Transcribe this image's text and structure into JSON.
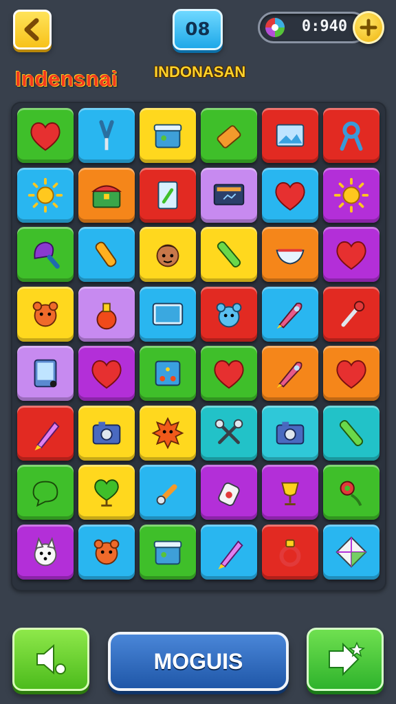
{
  "header": {
    "level": "08",
    "timer": "0:940",
    "title_left": "Indensnai",
    "title_center": "INDONASAN"
  },
  "footer": {
    "center_label": "MOGUIS"
  },
  "colors": {
    "green": "#3fbf2a",
    "blue": "#29b6f0",
    "yellow": "#ffd81e",
    "red": "#e22a22",
    "orange": "#f5861a",
    "purple": "#b32fd8",
    "lavender": "#c78af0",
    "cyan": "#2fc8d8",
    "teal": "#22c2c8"
  },
  "board": {
    "rows": [
      [
        {
          "color": "green",
          "icon": "heart-icon"
        },
        {
          "color": "blue",
          "icon": "scissors-icon"
        },
        {
          "color": "yellow",
          "icon": "box-icon"
        },
        {
          "color": "green",
          "icon": "eraser-icon"
        },
        {
          "color": "red",
          "icon": "picture-icon"
        },
        {
          "color": "red",
          "icon": "ribbon-icon"
        }
      ],
      [
        {
          "color": "blue",
          "icon": "sun-icon"
        },
        {
          "color": "orange",
          "icon": "treasure-chest-icon"
        },
        {
          "color": "red",
          "icon": "card-icon"
        },
        {
          "color": "lavender",
          "icon": "monitor-icon"
        },
        {
          "color": "blue",
          "icon": "heart-icon"
        },
        {
          "color": "purple",
          "icon": "sun-icon"
        }
      ],
      [
        {
          "color": "green",
          "icon": "brush-icon"
        },
        {
          "color": "blue",
          "icon": "marker-icon"
        },
        {
          "color": "yellow",
          "icon": "face-icon"
        },
        {
          "color": "yellow",
          "icon": "crayon-icon"
        },
        {
          "color": "orange",
          "icon": "bowl-icon"
        },
        {
          "color": "purple",
          "icon": "heart-icon"
        }
      ],
      [
        {
          "color": "yellow",
          "icon": "monster-icon"
        },
        {
          "color": "lavender",
          "icon": "potion-icon"
        },
        {
          "color": "blue",
          "icon": "tablet-icon"
        },
        {
          "color": "red",
          "icon": "creature-icon"
        },
        {
          "color": "blue",
          "icon": "rocket-icon"
        },
        {
          "color": "red",
          "icon": "wand-icon"
        }
      ],
      [
        {
          "color": "lavender",
          "icon": "device-icon"
        },
        {
          "color": "purple",
          "icon": "heart-icon"
        },
        {
          "color": "green",
          "icon": "game-board-icon"
        },
        {
          "color": "green",
          "icon": "heart-icon"
        },
        {
          "color": "orange",
          "icon": "rocket-icon"
        },
        {
          "color": "orange",
          "icon": "heart-icon"
        }
      ],
      [
        {
          "color": "red",
          "icon": "pencil-icon"
        },
        {
          "color": "yellow",
          "icon": "camera-icon"
        },
        {
          "color": "yellow",
          "icon": "spiky-monster-icon"
        },
        {
          "color": "teal",
          "icon": "crossed-tools-icon"
        },
        {
          "color": "cyan",
          "icon": "camera-icon"
        },
        {
          "color": "teal",
          "icon": "crayon-icon"
        }
      ],
      [
        {
          "color": "green",
          "icon": "speech-bubble-icon"
        },
        {
          "color": "yellow",
          "icon": "heart-trophy-icon"
        },
        {
          "color": "blue",
          "icon": "wrench-icon"
        },
        {
          "color": "purple",
          "icon": "can-icon"
        },
        {
          "color": "purple",
          "icon": "trophy-icon"
        },
        {
          "color": "green",
          "icon": "flower-icon"
        }
      ],
      [
        {
          "color": "purple",
          "icon": "dog-icon"
        },
        {
          "color": "blue",
          "icon": "monster-icon"
        },
        {
          "color": "green",
          "icon": "box-icon"
        },
        {
          "color": "blue",
          "icon": "pencil-icon"
        },
        {
          "color": "red",
          "icon": "ring-icon"
        },
        {
          "color": "blue",
          "icon": "diamond-icon"
        }
      ]
    ]
  }
}
